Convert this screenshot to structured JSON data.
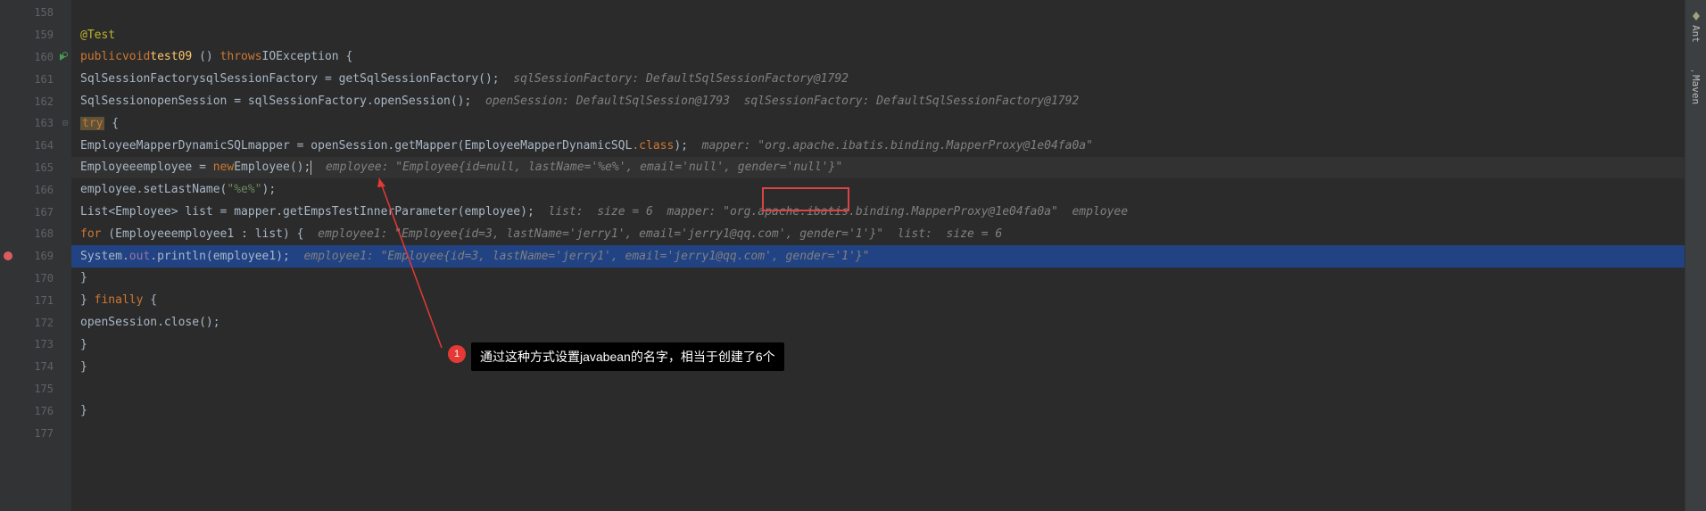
{
  "gutter": {
    "lines": [
      "158",
      "159",
      "160",
      "161",
      "162",
      "163",
      "164",
      "165",
      "166",
      "167",
      "168",
      "169",
      "170",
      "171",
      "172",
      "173",
      "174",
      "175",
      "176",
      "177"
    ],
    "icons": {
      "160": "run-recycle",
      "169": "breakpoint"
    }
  },
  "code": {
    "l159": {
      "anno": "@Test"
    },
    "l160": {
      "kw1": "public",
      "kw2": "void",
      "method": "test09",
      "kw3": "throws",
      "type": "IOException"
    },
    "l161": {
      "type1": "SqlSessionFactory",
      "var": "sqlSessionFactory",
      "method": "getSqlSessionFactory",
      "comment": "sqlSessionFactory: DefaultSqlSessionFactory@1792"
    },
    "l162": {
      "type1": "SqlSession",
      "var": "openSession",
      "var2": "sqlSessionFactory",
      "method": "openSession",
      "comment": "openSession: DefaultSqlSession@1793  sqlSessionFactory: DefaultSqlSessionFactory@1792"
    },
    "l163": {
      "kw": "try"
    },
    "l164": {
      "type": "EmployeeMapperDynamicSQL",
      "var": "mapper",
      "var2": "openSession",
      "method": "getMapper",
      "arg": "EmployeeMapperDynamicSQL",
      "kw": ".class",
      "comment": "mapper: \"org.apache.ibatis.binding.MapperProxy@1e04fa0a\""
    },
    "l165": {
      "type": "Employee",
      "var": "employee",
      "kw": "new",
      "ctor": "Employee",
      "comment": "employee: \"Employee{id=null, lastName='%e%', email='null', gender='null'}\""
    },
    "l166": {
      "var": "employee",
      "method": "setLastName",
      "str": "\"%e%\""
    },
    "l167": {
      "type": "List",
      "generic": "Employee",
      "var": "list",
      "var2": "mapper",
      "method": "getEmpsTestInnerParameter",
      "arg": "employee",
      "comment1": "list: ",
      "comment2": " size = 6 ",
      "comment3": " mapper: \"org.apache.ibatis.binding.MapperProxy@1e04fa0a\"  employee"
    },
    "l168": {
      "kw": "for",
      "type": "Employee",
      "var": "employee1",
      "var2": "list",
      "comment": "employee1: \"Employee{id=3, lastName='jerry1', email='jerry1@qq.com', gender='1'}\"  list:  size = 6"
    },
    "l169": {
      "cls": "System",
      "field": "out",
      "method": "println",
      "arg": "employee1",
      "comment": "employee1: \"Employee{id=3, lastName='jerry1', email='jerry1@qq.com', gender='1'}\""
    },
    "l171": {
      "kw": "finally"
    },
    "l172": {
      "var": "openSession",
      "method": "close"
    }
  },
  "annotation": {
    "badge": "1",
    "text": "通过这种方式设置javabean的名字，相当于创建了6个"
  },
  "rightPanel": {
    "tab1": "Ant",
    "tab2": "Maven"
  }
}
